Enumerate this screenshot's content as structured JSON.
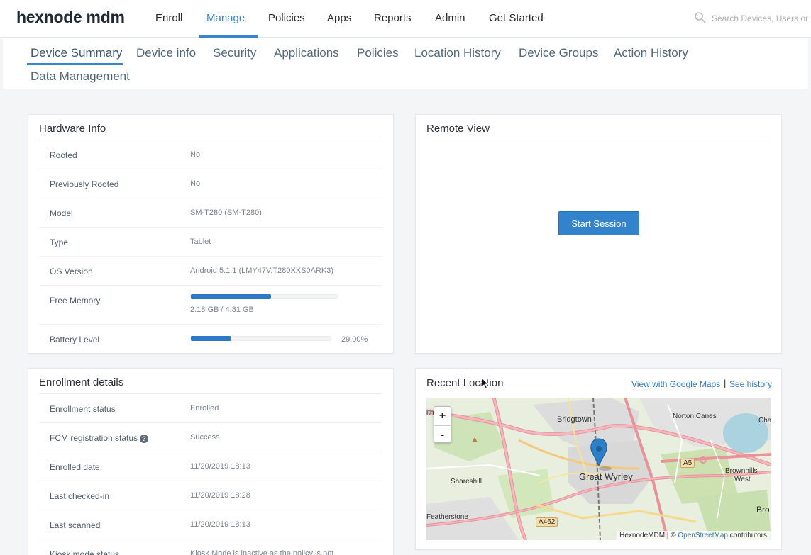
{
  "topnav": {
    "logo": "hexnode mdm",
    "items": [
      "Enroll",
      "Manage",
      "Policies",
      "Apps",
      "Reports",
      "Admin",
      "Get Started"
    ],
    "active": "Manage",
    "search_placeholder": "Search Devices, Users or P"
  },
  "subtabs": {
    "items": [
      "Device Summary",
      "Device info",
      "Security",
      "Applications",
      "Policies",
      "Location History",
      "Device Groups",
      "Action History",
      "Data Management"
    ],
    "active": "Device Summary"
  },
  "hardware": {
    "title": "Hardware Info",
    "rows": [
      {
        "label": "Rooted",
        "value": "No"
      },
      {
        "label": "Previously Rooted",
        "value": "No"
      },
      {
        "label": "Model",
        "value": "SM-T280 (SM-T280)"
      },
      {
        "label": "Type",
        "value": "Tablet"
      },
      {
        "label": "OS Version",
        "value": "Android 5.1.1 (LMY47V.T280XXS0ARK3)"
      }
    ],
    "free_memory": {
      "label": "Free Memory",
      "value": "2.18 GB / 4.81 GB",
      "fraction": 0.547
    },
    "battery": {
      "label": "Battery Level",
      "value": "29.00%",
      "fraction": 0.29
    }
  },
  "enrollment": {
    "title": "Enrollment details",
    "rows": [
      {
        "label": "Enrollment status",
        "value": "Enrolled"
      },
      {
        "label": "FCM registration status",
        "value": "Success"
      },
      {
        "label": "Enrolled date",
        "value": "11/20/2019 18:13"
      },
      {
        "label": "Last checked-in",
        "value": "11/20/2019 18:28"
      },
      {
        "label": "Last scanned",
        "value": "11/20/2019 18:13"
      },
      {
        "label": "Kiosk mode status",
        "value": "Kiosk Mode is inactive as the policy is not"
      }
    ]
  },
  "remote_view": {
    "title": "Remote View",
    "button": "Start Session"
  },
  "recent_location": {
    "title": "Recent Location",
    "google_link": "View with Google Maps",
    "separator": "|",
    "history_link": "See history",
    "zoom_in": "+",
    "zoom_out": "-",
    "places": {
      "bridgtown": "Bridgtown",
      "norton_canes": "Norton Canes",
      "great_wyrley": "Great Wyrley",
      "shareshill": "Shareshill",
      "brownhills_west_1": "Brownhills",
      "brownhills_west_2": "West",
      "featherstone": "Featherstone",
      "bro": "Bro",
      "cha": "Cha",
      "ith": "ith",
      "a5": "A5",
      "a462": "A462"
    },
    "attribution": {
      "prefix": "HexnodeMDM | © ",
      "osm": "OpenStreetMap",
      "suffix": " contributors"
    }
  },
  "colors": {
    "accent": "#3784d3",
    "bar": "#2f78c8",
    "button": "#3382cc"
  }
}
